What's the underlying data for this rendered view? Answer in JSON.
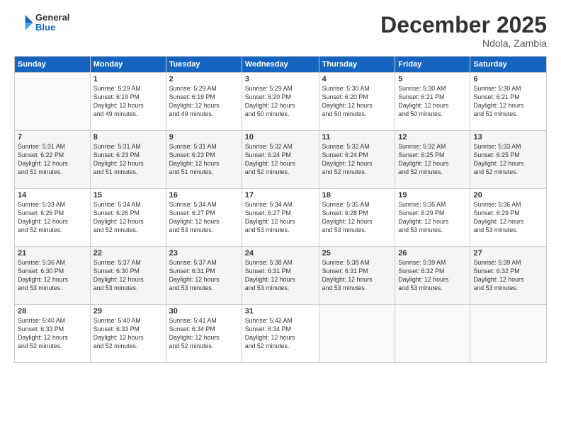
{
  "header": {
    "logo_general": "General",
    "logo_blue": "Blue",
    "month": "December 2025",
    "location": "Ndola, Zambia"
  },
  "weekdays": [
    "Sunday",
    "Monday",
    "Tuesday",
    "Wednesday",
    "Thursday",
    "Friday",
    "Saturday"
  ],
  "weeks": [
    [
      {
        "day": "",
        "info": ""
      },
      {
        "day": "1",
        "info": "Sunrise: 5:29 AM\nSunset: 6:19 PM\nDaylight: 12 hours\nand 49 minutes."
      },
      {
        "day": "2",
        "info": "Sunrise: 5:29 AM\nSunset: 6:19 PM\nDaylight: 12 hours\nand 49 minutes."
      },
      {
        "day": "3",
        "info": "Sunrise: 5:29 AM\nSunset: 6:20 PM\nDaylight: 12 hours\nand 50 minutes."
      },
      {
        "day": "4",
        "info": "Sunrise: 5:30 AM\nSunset: 6:20 PM\nDaylight: 12 hours\nand 50 minutes."
      },
      {
        "day": "5",
        "info": "Sunrise: 5:30 AM\nSunset: 6:21 PM\nDaylight: 12 hours\nand 50 minutes."
      },
      {
        "day": "6",
        "info": "Sunrise: 5:30 AM\nSunset: 6:21 PM\nDaylight: 12 hours\nand 51 minutes."
      }
    ],
    [
      {
        "day": "7",
        "info": "Sunrise: 5:31 AM\nSunset: 6:22 PM\nDaylight: 12 hours\nand 51 minutes."
      },
      {
        "day": "8",
        "info": "Sunrise: 5:31 AM\nSunset: 6:23 PM\nDaylight: 12 hours\nand 51 minutes."
      },
      {
        "day": "9",
        "info": "Sunrise: 5:31 AM\nSunset: 6:23 PM\nDaylight: 12 hours\nand 51 minutes."
      },
      {
        "day": "10",
        "info": "Sunrise: 5:32 AM\nSunset: 6:24 PM\nDaylight: 12 hours\nand 52 minutes."
      },
      {
        "day": "11",
        "info": "Sunrise: 5:32 AM\nSunset: 6:24 PM\nDaylight: 12 hours\nand 52 minutes."
      },
      {
        "day": "12",
        "info": "Sunrise: 5:32 AM\nSunset: 6:25 PM\nDaylight: 12 hours\nand 52 minutes."
      },
      {
        "day": "13",
        "info": "Sunrise: 5:33 AM\nSunset: 6:25 PM\nDaylight: 12 hours\nand 52 minutes."
      }
    ],
    [
      {
        "day": "14",
        "info": "Sunrise: 5:33 AM\nSunset: 6:26 PM\nDaylight: 12 hours\nand 52 minutes."
      },
      {
        "day": "15",
        "info": "Sunrise: 5:34 AM\nSunset: 6:26 PM\nDaylight: 12 hours\nand 52 minutes."
      },
      {
        "day": "16",
        "info": "Sunrise: 5:34 AM\nSunset: 6:27 PM\nDaylight: 12 hours\nand 53 minutes."
      },
      {
        "day": "17",
        "info": "Sunrise: 5:34 AM\nSunset: 6:27 PM\nDaylight: 12 hours\nand 53 minutes."
      },
      {
        "day": "18",
        "info": "Sunrise: 5:35 AM\nSunset: 6:28 PM\nDaylight: 12 hours\nand 53 minutes."
      },
      {
        "day": "19",
        "info": "Sunrise: 5:35 AM\nSunset: 6:29 PM\nDaylight: 12 hours\nand 53 minutes."
      },
      {
        "day": "20",
        "info": "Sunrise: 5:36 AM\nSunset: 6:29 PM\nDaylight: 12 hours\nand 53 minutes."
      }
    ],
    [
      {
        "day": "21",
        "info": "Sunrise: 5:36 AM\nSunset: 6:30 PM\nDaylight: 12 hours\nand 53 minutes."
      },
      {
        "day": "22",
        "info": "Sunrise: 5:37 AM\nSunset: 6:30 PM\nDaylight: 12 hours\nand 53 minutes."
      },
      {
        "day": "23",
        "info": "Sunrise: 5:37 AM\nSunset: 6:31 PM\nDaylight: 12 hours\nand 53 minutes."
      },
      {
        "day": "24",
        "info": "Sunrise: 5:38 AM\nSunset: 6:31 PM\nDaylight: 12 hours\nand 53 minutes."
      },
      {
        "day": "25",
        "info": "Sunrise: 5:38 AM\nSunset: 6:31 PM\nDaylight: 12 hours\nand 53 minutes."
      },
      {
        "day": "26",
        "info": "Sunrise: 5:39 AM\nSunset: 6:32 PM\nDaylight: 12 hours\nand 53 minutes."
      },
      {
        "day": "27",
        "info": "Sunrise: 5:39 AM\nSunset: 6:32 PM\nDaylight: 12 hours\nand 53 minutes."
      }
    ],
    [
      {
        "day": "28",
        "info": "Sunrise: 5:40 AM\nSunset: 6:33 PM\nDaylight: 12 hours\nand 52 minutes."
      },
      {
        "day": "29",
        "info": "Sunrise: 5:40 AM\nSunset: 6:33 PM\nDaylight: 12 hours\nand 52 minutes."
      },
      {
        "day": "30",
        "info": "Sunrise: 5:41 AM\nSunset: 6:34 PM\nDaylight: 12 hours\nand 52 minutes."
      },
      {
        "day": "31",
        "info": "Sunrise: 5:42 AM\nSunset: 6:34 PM\nDaylight: 12 hours\nand 52 minutes."
      },
      {
        "day": "",
        "info": ""
      },
      {
        "day": "",
        "info": ""
      },
      {
        "day": "",
        "info": ""
      }
    ]
  ]
}
